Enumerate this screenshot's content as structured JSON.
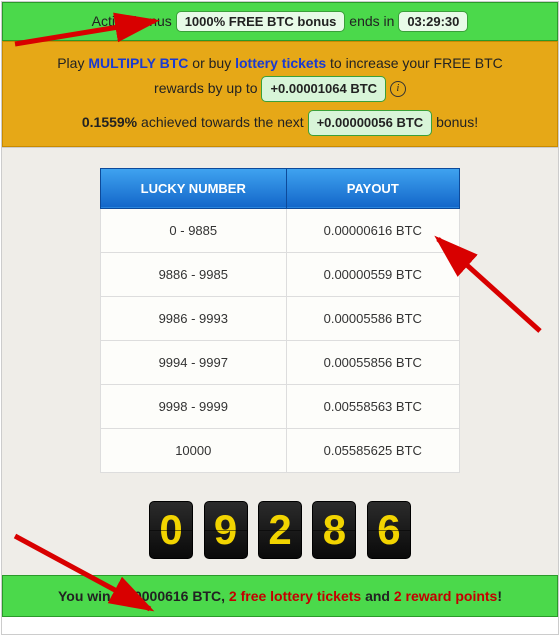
{
  "top": {
    "prefix": "Active bonus",
    "bonus_label": "1000% FREE BTC bonus",
    "mid": "ends in",
    "timer": "03:29:30"
  },
  "yellow": {
    "t1": "Play ",
    "link1": "MULTIPLY BTC",
    "t2": " or buy ",
    "link2": "lottery tickets",
    "t3": " to increase your FREE BTC",
    "t4": "rewards by up to ",
    "reward_pill": "+0.00001064 BTC",
    "row2_pct": "0.1559%",
    "row2_mid": " achieved towards the next ",
    "row2_pill": "+0.00000056 BTC",
    "row2_end": " bonus!"
  },
  "table": {
    "h1": "LUCKY NUMBER",
    "h2": "PAYOUT",
    "rows": [
      {
        "range": "0 - 9885",
        "payout": "0.00000616 BTC"
      },
      {
        "range": "9886 - 9985",
        "payout": "0.00000559 BTC"
      },
      {
        "range": "9986 - 9993",
        "payout": "0.00005586 BTC"
      },
      {
        "range": "9994 - 9997",
        "payout": "0.00055856 BTC"
      },
      {
        "range": "9998 - 9999",
        "payout": "0.00558563 BTC"
      },
      {
        "range": "10000",
        "payout": "0.05585625 BTC"
      }
    ]
  },
  "roll": {
    "d0": "0",
    "d1": "9",
    "d2": "2",
    "d3": "8",
    "d4": "6"
  },
  "win": {
    "t1": "You win 0.00000616 BTC, ",
    "r1": "2 free lottery tickets",
    "t2": " and ",
    "r2": "2 reward points",
    "t3": "!"
  }
}
